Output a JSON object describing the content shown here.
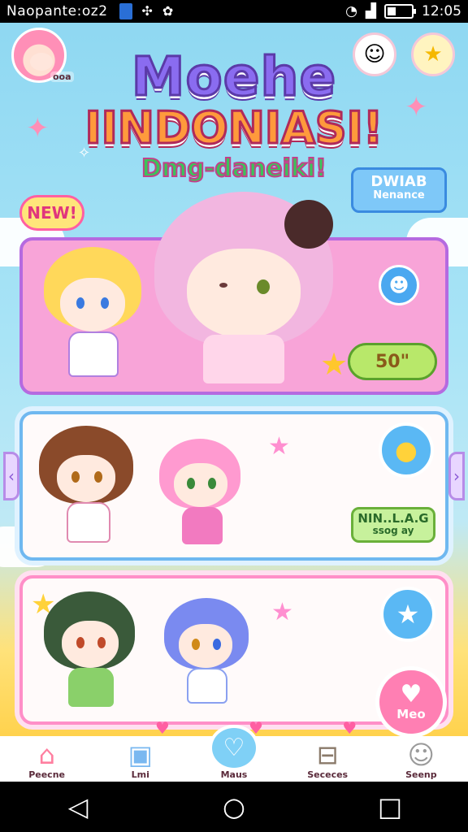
{
  "status_bar": {
    "left_text": "Naopante:oz2",
    "time": "12:05",
    "battery_level": 0.3
  },
  "header": {
    "avatar_tag": "ooa"
  },
  "hero": {
    "title_line1": "Moehe",
    "title_line2": "IINDONIASI!",
    "subtitle": "Dmg-daneiki!",
    "new_badge": "NEW!",
    "speech_line1": "DWIAB",
    "speech_line2": "Nenance"
  },
  "cards": {
    "featured_score": "50\"",
    "card2_tag_line1": "NIN..L.A.G",
    "card2_tag_line2": "ssog  ay"
  },
  "fab": {
    "label": "Meo"
  },
  "bottom_nav": [
    {
      "label": "Peecne",
      "icon": "house-icon"
    },
    {
      "label": "Lmi",
      "icon": "gift-box-icon"
    },
    {
      "label": "Maus",
      "icon": "heart-icon"
    },
    {
      "label": "Sececes",
      "icon": "shop-basket-icon"
    },
    {
      "label": "Seenp",
      "icon": "mascot-icon"
    }
  ],
  "colors": {
    "accent_pink": "#ff7fb3",
    "accent_blue": "#5ab8f4",
    "card_featured": "#f8a4d8"
  }
}
